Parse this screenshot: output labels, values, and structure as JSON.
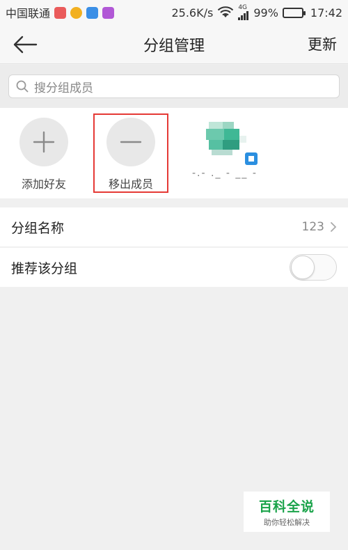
{
  "status_bar": {
    "carrier": "中国联通",
    "network_speed": "25.6K/s",
    "network_type": "4G",
    "battery": "99%",
    "battery_level": 0.99,
    "time": "17:42",
    "app_icon_colors": [
      "#ea5b5b",
      "#f2b020",
      "#3b8fe6",
      "#b158d6"
    ]
  },
  "nav": {
    "title": "分组管理",
    "update_label": "更新"
  },
  "search": {
    "placeholder": "搜分组成员"
  },
  "members": {
    "add_label": "添加好友",
    "remove_label": "移出成员",
    "member_name": "-.- ._ - __ -"
  },
  "list": {
    "group_name_label": "分组名称",
    "group_name_value": "123",
    "recommend_label": "推荐该分组",
    "recommend_on": false
  },
  "watermark": {
    "title": "百科全说",
    "subtitle": "助你轻松解决"
  },
  "colors": {
    "highlight": "#e53935",
    "brand_green": "#1aa34a"
  }
}
